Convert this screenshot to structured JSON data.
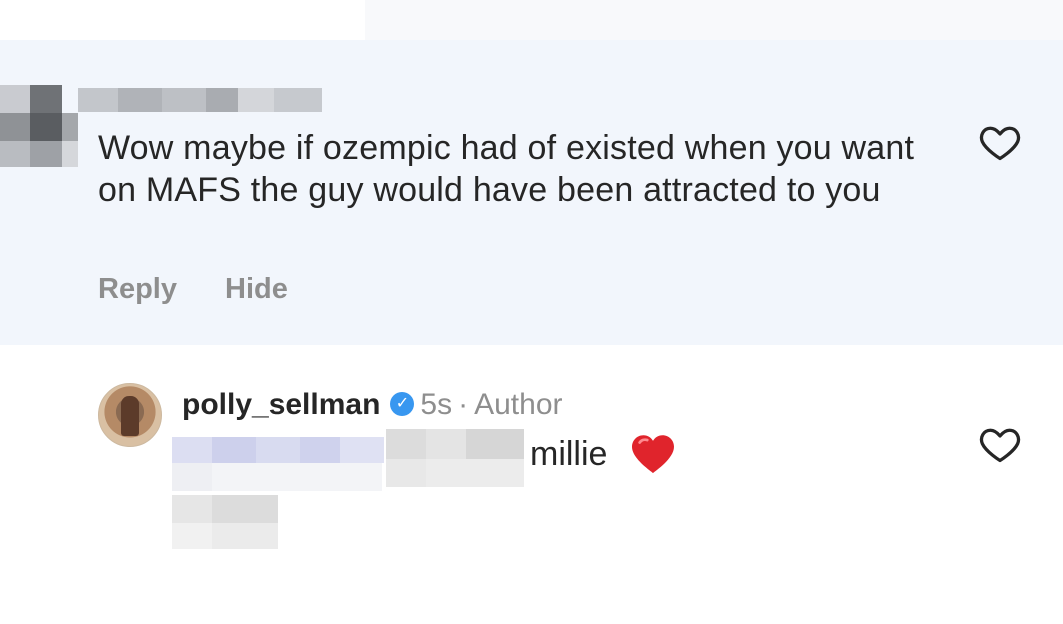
{
  "comment": {
    "text": "Wow maybe if ozempic had of existed when you want on MAFS the guy would have been attracted to you",
    "reply_label": "Reply",
    "hide_label": "Hide",
    "like_icon": "heart-outline-icon"
  },
  "reply": {
    "username": "polly_sellman",
    "verified_icon": "verified-badge-icon",
    "time": "5s",
    "separator": "·",
    "role": "Author",
    "text": "millie",
    "emoji_icon": "red-heart-icon",
    "like_icon": "heart-outline-icon"
  },
  "colors": {
    "comment_bg": "#f2f6fc",
    "text": "#262626",
    "muted": "#8e8e8e",
    "verified": "#3897f0",
    "heart_red": "#e0242c"
  }
}
